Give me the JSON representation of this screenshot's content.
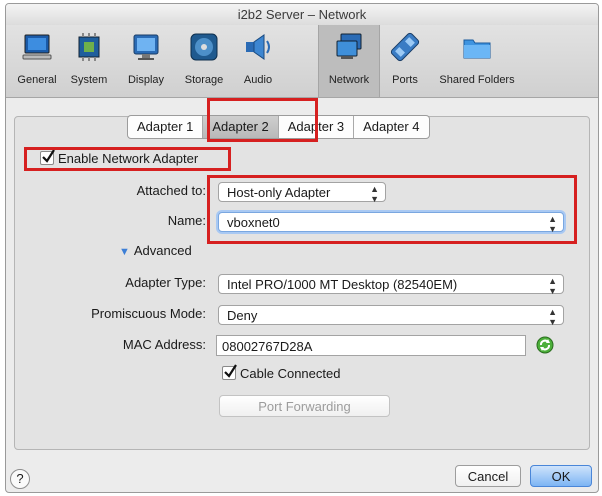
{
  "window": {
    "title": "i2b2 Server – Network"
  },
  "toolbar": {
    "items": [
      {
        "label": "General",
        "icon": "general-icon"
      },
      {
        "label": "System",
        "icon": "system-icon"
      },
      {
        "label": "Display",
        "icon": "display-icon"
      },
      {
        "label": "Storage",
        "icon": "storage-icon"
      },
      {
        "label": "Audio",
        "icon": "audio-icon"
      },
      {
        "label": "Network",
        "icon": "network-icon",
        "selected": true
      },
      {
        "label": "Ports",
        "icon": "ports-icon"
      },
      {
        "label": "Shared Folders",
        "icon": "shared-folders-icon"
      }
    ]
  },
  "tabs": [
    {
      "label": "Adapter 1"
    },
    {
      "label": "Adapter 2",
      "active": true
    },
    {
      "label": "Adapter 3"
    },
    {
      "label": "Adapter 4"
    }
  ],
  "form": {
    "enable_adapter": {
      "label": "Enable Network Adapter",
      "checked": true
    },
    "attached_to": {
      "label": "Attached to:",
      "value": "Host-only Adapter"
    },
    "name": {
      "label": "Name:",
      "value": "vboxnet0"
    },
    "advanced": {
      "label": "Advanced"
    },
    "adapter_type": {
      "label": "Adapter Type:",
      "value": "Intel PRO/1000 MT Desktop (82540EM)"
    },
    "promiscuous": {
      "label": "Promiscuous Mode:",
      "value": "Deny"
    },
    "mac": {
      "label": "MAC Address:",
      "value": "08002767D28A"
    },
    "cable": {
      "label": "Cable Connected",
      "checked": true
    },
    "port_forwarding": {
      "label": "Port Forwarding"
    }
  },
  "footer": {
    "help": "?",
    "cancel": "Cancel",
    "ok": "OK"
  },
  "colors": {
    "highlight": "#d62020",
    "accent": "#4a86d8"
  }
}
